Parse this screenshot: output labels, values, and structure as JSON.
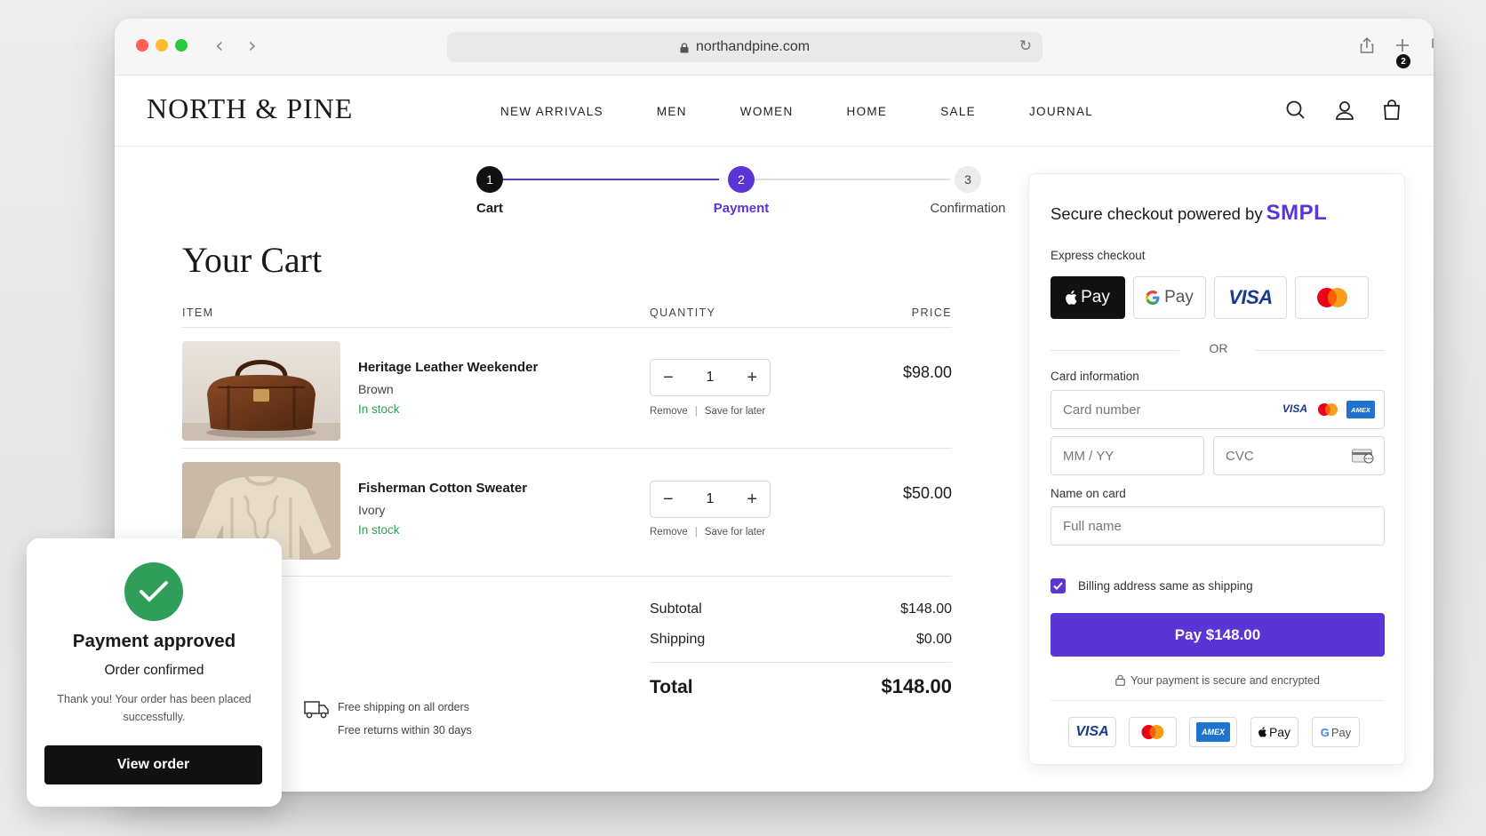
{
  "browser": {
    "url": "northandpine.com"
  },
  "site": {
    "logo": "NORTH & PINE",
    "nav": [
      "NEW ARRIVALS",
      "MEN",
      "WOMEN",
      "HOME",
      "SALE",
      "JOURNAL"
    ],
    "cart_count": "2"
  },
  "steps": [
    {
      "number": "1",
      "label": "Cart",
      "state": "complete"
    },
    {
      "number": "2",
      "label": "Payment",
      "state": "active"
    },
    {
      "number": "3",
      "label": "Confirmation",
      "state": "upcoming"
    }
  ],
  "cart": {
    "title": "Your Cart",
    "headers": {
      "item": "ITEM",
      "quantity": "QUANTITY",
      "price": "PRICE"
    },
    "items": [
      {
        "name": "Heritage Leather Weekender",
        "variant": "Brown",
        "stock": "In stock",
        "quantity": "1",
        "price": "$98.00",
        "remove": "Remove",
        "save": "Save for later",
        "sep": "|"
      },
      {
        "name": "Fisherman Cotton Sweater",
        "variant": "Ivory",
        "stock": "In stock",
        "quantity": "1",
        "price": "$50.00",
        "remove": "Remove",
        "save": "Save for later",
        "sep": "|"
      }
    ],
    "summary": {
      "subtotal_label": "Subtotal",
      "subtotal": "$148.00",
      "shipping_label": "Shipping",
      "shipping": "$0.00",
      "total_label": "Total",
      "total": "$148.00"
    },
    "perks": [
      "Free shipping on all orders",
      "Free returns within 30 days"
    ]
  },
  "checkout": {
    "title": "Secure checkout powered by",
    "brand": "SMPL",
    "express_label": "Express checkout",
    "express": {
      "apple": "Pay",
      "google": "Pay",
      "visa": "VISA"
    },
    "or": "OR",
    "card_info_label": "Card information",
    "card_number_placeholder": "Card number",
    "expiry_placeholder": "MM / YY",
    "cvc_placeholder": "CVC",
    "name_label": "Name on card",
    "name_placeholder": "Full name",
    "billing_same": "Billing address same as shipping",
    "billing_checked": true,
    "pay_button": "Pay $148.00",
    "secure_note": "Your payment is secure and encrypted",
    "card_marks": {
      "visa": "VISA",
      "amex": "AMEX",
      "apple_pay": "Pay",
      "google_pay": "Pay"
    },
    "accent": "#5b34d6"
  },
  "toast": {
    "title": "Payment approved",
    "subtitle": "Order confirmed",
    "body": "Thank you! Your order has been placed successfully.",
    "button": "View order",
    "color": "#2f9e58"
  }
}
